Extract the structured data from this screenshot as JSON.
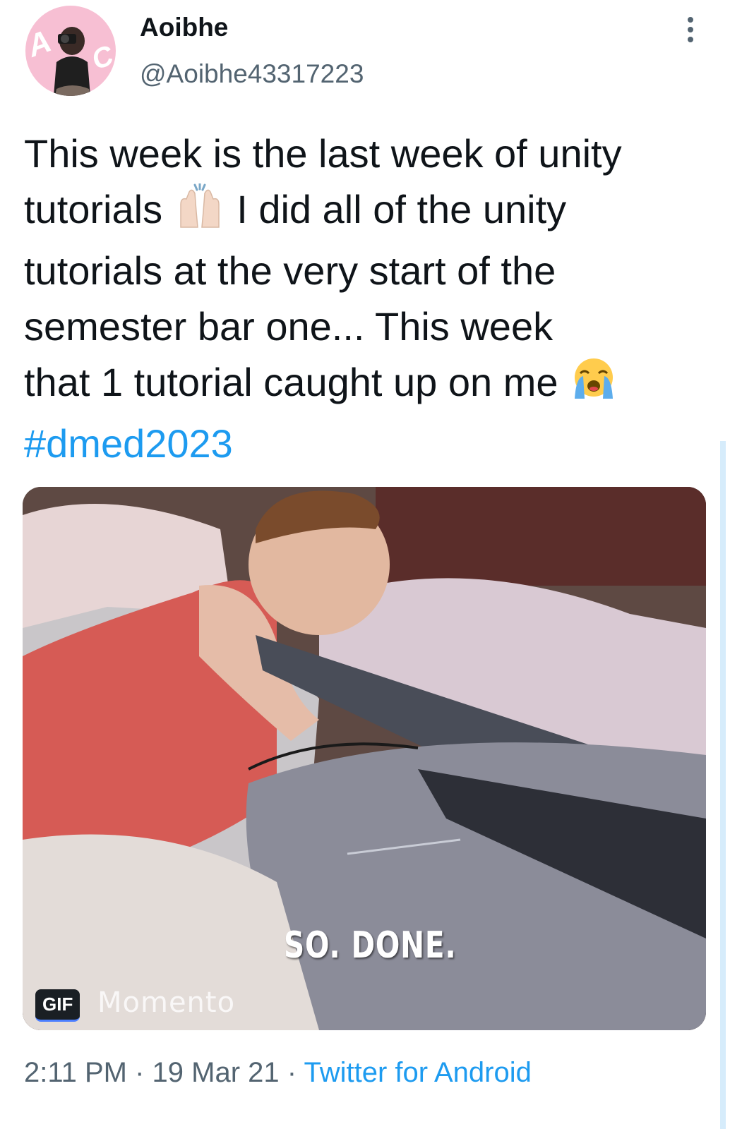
{
  "user": {
    "display_name": "Aoibhe",
    "handle": "@Aoibhe43317223",
    "avatar_monogram": "AC"
  },
  "tweet": {
    "lines": [
      "This week is the last week of unity",
      "tutorials",
      "I did all of the unity",
      "tutorials at the very start of the",
      "semester bar one... This week",
      "that 1 tutorial caught up on me"
    ],
    "hashtag": "#dmed2023",
    "emojis": [
      "raising-hands-emoji",
      "loudly-crying-face-emoji"
    ]
  },
  "media": {
    "caption": "SO. DONE.",
    "badge": "GIF",
    "watermark": "Momento"
  },
  "meta": {
    "time": "2:11 PM",
    "separator": " · ",
    "date": "19 Mar 21",
    "source": "Twitter for Android"
  },
  "colors": {
    "link": "#1d9bf0",
    "secondary_text": "#536471",
    "avatar_bg": "#f7bfd3"
  }
}
